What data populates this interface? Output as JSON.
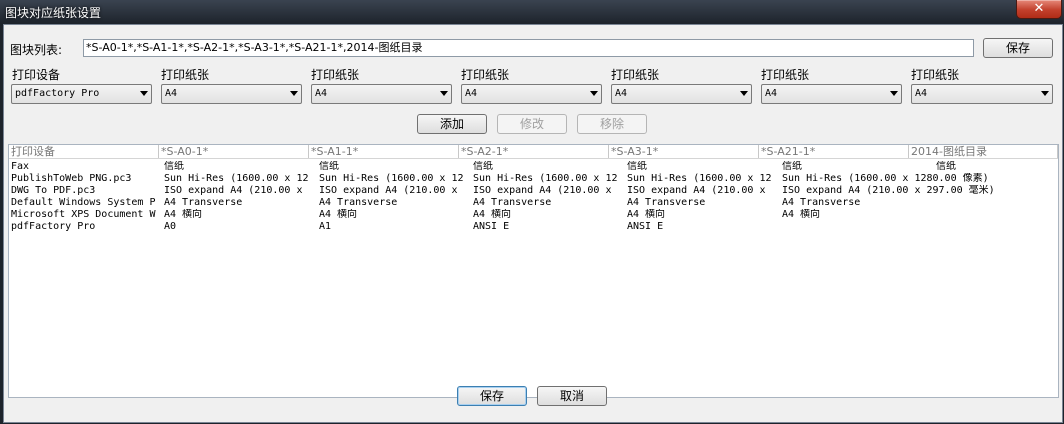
{
  "window": {
    "title": "图块对应纸张设置",
    "close_glyph": "✕"
  },
  "block_list": {
    "label": "图块列表:",
    "value": "*S-A0-1*,*S-A1-1*,*S-A2-1*,*S-A3-1*,*S-A21-1*,2014-图纸目录",
    "save_label": "保存"
  },
  "selectors": [
    {
      "label": "打印设备",
      "value": "pdfFactory Pro"
    },
    {
      "label": "打印纸张",
      "value": "A4"
    },
    {
      "label": "打印纸张",
      "value": "A4"
    },
    {
      "label": "打印纸张",
      "value": "A4"
    },
    {
      "label": "打印纸张",
      "value": "A4"
    },
    {
      "label": "打印纸张",
      "value": "A4"
    },
    {
      "label": "打印纸张",
      "value": "A4"
    }
  ],
  "actions": {
    "add": "添加",
    "modify": "修改",
    "remove": "移除"
  },
  "table": {
    "columns": [
      "打印设备",
      "*S-A0-1*",
      "*S-A1-1*",
      "*S-A2-1*",
      "*S-A3-1*",
      "*S-A21-1*",
      "2014-图纸目录"
    ],
    "rows": [
      [
        "Fax",
        "信纸",
        "信纸",
        "信纸",
        "信纸",
        "信纸",
        "信纸"
      ],
      [
        "PublishToWeb PNG.pc3",
        "Sun Hi-Res (1600.00 x 12",
        "Sun Hi-Res (1600.00 x 12",
        "Sun Hi-Res (1600.00 x 12",
        "Sun Hi-Res (1600.00 x 12",
        "Sun Hi-Res (1600.00 x 1280.00 像素)",
        ""
      ],
      [
        "DWG To PDF.pc3",
        "ISO expand A4 (210.00 x",
        "ISO expand A4 (210.00 x",
        "ISO expand A4 (210.00 x",
        "ISO expand A4 (210.00 x",
        "ISO expand A4 (210.00 x 297.00 毫米)",
        ""
      ],
      [
        "Default Windows System P",
        "A4 Transverse",
        "A4 Transverse",
        "A4 Transverse",
        "A4 Transverse",
        "A4 Transverse",
        ""
      ],
      [
        "Microsoft XPS Document W",
        "A4 横向",
        "A4 横向",
        "A4 横向",
        "A4 横向",
        "A4 横向",
        ""
      ],
      [
        "pdfFactory Pro",
        "A0",
        "A1",
        "ANSI E",
        "ANSI E",
        "",
        ""
      ]
    ]
  },
  "footer": {
    "save": "保存",
    "cancel": "取消"
  }
}
